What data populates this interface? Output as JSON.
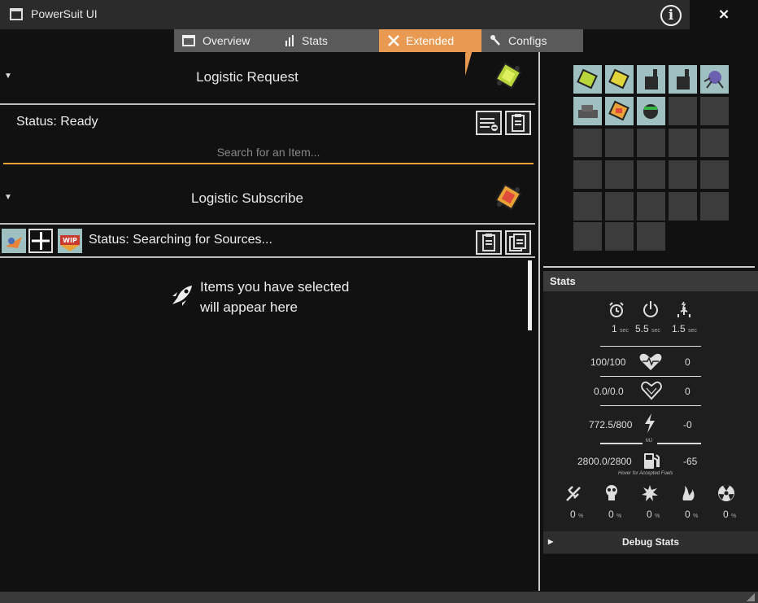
{
  "window": {
    "title": "PowerSuit UI",
    "info_icon": "info-icon",
    "close_label": "×"
  },
  "tabs": [
    {
      "label": "Overview",
      "icon": "window-icon"
    },
    {
      "label": "Stats",
      "icon": "bar-chart-icon"
    },
    {
      "label": "Extended",
      "icon": "tools-icon",
      "active": true
    },
    {
      "label": "Configs",
      "icon": "wrench-icon"
    }
  ],
  "logistic_request": {
    "title": "Logistic Request",
    "status": "Status: Ready",
    "search_placeholder": "Search for an Item..."
  },
  "logistic_subscribe": {
    "title": "Logistic Subscribe",
    "status": "Status: Searching for Sources...",
    "empty_line1": "Items you have selected",
    "empty_line2": "will appear here"
  },
  "stats": {
    "header": "Stats",
    "timers": [
      {
        "value": "1",
        "unit": "sec",
        "icon": "alarm-clock-icon"
      },
      {
        "value": "5.5",
        "unit": "sec",
        "icon": "power-icon"
      },
      {
        "value": "1.5",
        "unit": "sec",
        "icon": "jump-icon"
      }
    ],
    "health": {
      "value": "100/100",
      "regen": "0",
      "icon": "heart-icon"
    },
    "shield": {
      "value": "0.0/0.0",
      "regen": "0",
      "icon": "shield-heart-icon"
    },
    "energy": {
      "value": "772.5/800",
      "delta": "-0",
      "unit": "MJ",
      "icon": "lightning-icon"
    },
    "fuel": {
      "value": "2800.0/2800",
      "delta": "-65",
      "note": "Hover for Accepted Fuels",
      "icon": "fuel-pump-icon"
    },
    "resistances": [
      {
        "value": "0",
        "unit": "%",
        "icon": "physical-icon"
      },
      {
        "value": "0",
        "unit": "%",
        "icon": "acid-icon"
      },
      {
        "value": "0",
        "unit": "%",
        "icon": "explosion-icon"
      },
      {
        "value": "0",
        "unit": "%",
        "icon": "fire-icon"
      },
      {
        "value": "0",
        "unit": "%",
        "icon": "radiation-icon"
      }
    ],
    "debug_label": "Debug Stats"
  },
  "colors": {
    "accent": "#e89a52",
    "search_underline": "#e8a236"
  }
}
